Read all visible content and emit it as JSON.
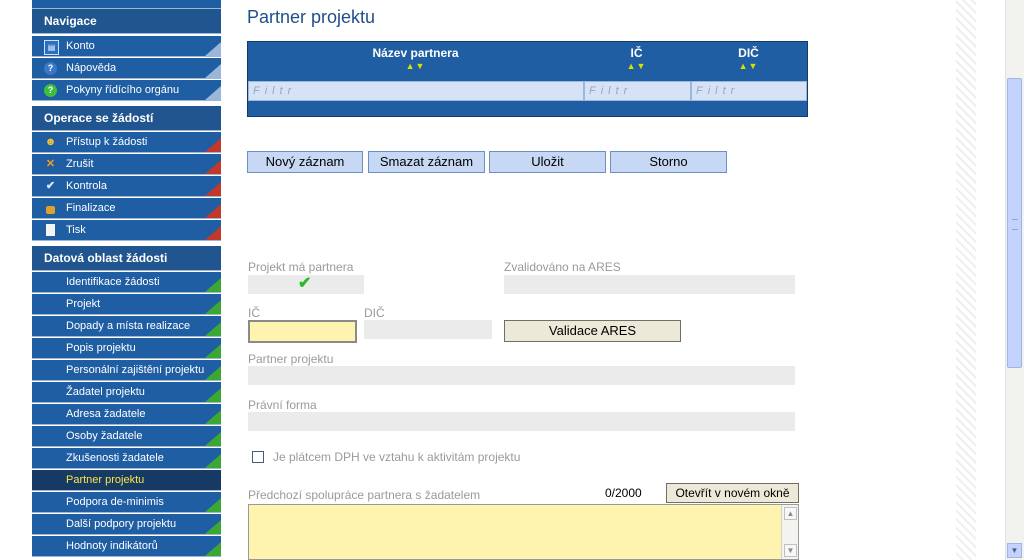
{
  "sidebar": {
    "navigation_title": "Navigace",
    "navigation_items": [
      {
        "label": "Konto",
        "icon": "account-icon"
      },
      {
        "label": "Nápověda",
        "icon": "help-icon"
      },
      {
        "label": "Pokyny řídícího orgánu",
        "icon": "guidelines-icon"
      }
    ],
    "operations_title": "Operace se žádostí",
    "operations_items": [
      {
        "label": "Přístup k žádosti",
        "icon": "users-icon"
      },
      {
        "label": "Zrušit",
        "icon": "cancel-icon"
      },
      {
        "label": "Kontrola",
        "icon": "checkmark-icon"
      },
      {
        "label": "Finalizace",
        "icon": "lock-icon"
      },
      {
        "label": "Tisk",
        "icon": "print-icon"
      }
    ],
    "data_title": "Datová oblast žádosti",
    "data_items": [
      {
        "label": "Identifikace žádosti"
      },
      {
        "label": "Projekt"
      },
      {
        "label": "Dopady a místa realizace"
      },
      {
        "label": "Popis projektu"
      },
      {
        "label": "Personální zajištění projektu"
      },
      {
        "label": "Žadatel projektu"
      },
      {
        "label": "Adresa žadatele"
      },
      {
        "label": "Osoby žadatele"
      },
      {
        "label": "Zkušenosti žadatele"
      },
      {
        "label": "Partner projektu",
        "active": true
      },
      {
        "label": "Podpora de-minimis"
      },
      {
        "label": "Další podpory projektu"
      },
      {
        "label": "Hodnoty indikátorů"
      }
    ]
  },
  "main": {
    "title": "Partner projektu",
    "grid": {
      "columns": [
        "Název partnera",
        "IČ",
        "DIČ"
      ],
      "sort_glyph": "▲▼",
      "filter_placeholder": "Filtr"
    },
    "buttons": {
      "new": "Nový záznam",
      "delete": "Smazat záznam",
      "save": "Uložit",
      "cancel": "Storno"
    },
    "form": {
      "has_partner_label": "Projekt má partnera",
      "validated_label": "Zvalidováno na ARES",
      "ic_label": "IČ",
      "dic_label": "DIČ",
      "validate_button": "Validace ARES",
      "partner_label": "Partner projektu",
      "legal_form_label": "Právní forma",
      "vat_checkbox_label": "Je plátcem DPH ve vztahu k aktivitám projektu",
      "cooperation_label": "Předchozí spolupráce partnera s žadatelem",
      "char_counter": "0/2000",
      "open_window_button": "Otevřít v novém okně"
    }
  },
  "colors": {
    "sidebar_bg": "#1f5ea3",
    "sidebar_active_bg": "#163a64",
    "sidebar_active_text": "#ffe44a",
    "title_color": "#1f4f8a",
    "input_required": "#fff3b0"
  }
}
